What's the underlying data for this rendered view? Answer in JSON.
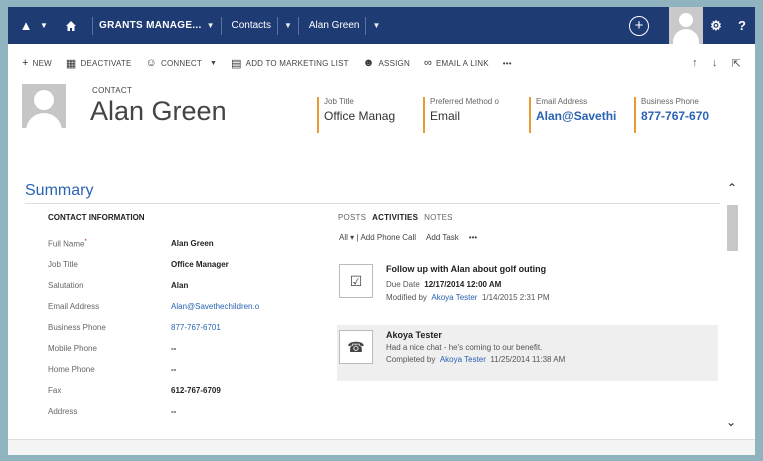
{
  "nav": {
    "module_label": "GRANTS MANAGE...",
    "entity_label": "Contacts",
    "record_label": "Alan Green",
    "help_label": "?"
  },
  "commands": {
    "new": "NEW",
    "deactivate": "DEACTIVATE",
    "connect": "CONNECT",
    "add_to_marketing_list": "ADD TO MARKETING LIST",
    "assign": "ASSIGN",
    "email_link": "EMAIL A LINK",
    "more": "•••"
  },
  "header": {
    "entity_type": "CONTACT",
    "name": "Alan Green",
    "fields": [
      {
        "label": "Job Title",
        "value": "Office Manag"
      },
      {
        "label": "Preferred Method o",
        "value": "Email"
      },
      {
        "label": "Email Address",
        "value": "Alan@Savethi"
      },
      {
        "label": "Business Phone",
        "value": "877-767-670"
      }
    ]
  },
  "summary": {
    "title": "Summary",
    "section_title": "CONTACT INFORMATION",
    "rows": [
      {
        "label": "Full Name",
        "required": "*",
        "value": "Alan Green"
      },
      {
        "label": "Job Title",
        "value": "Office Manager"
      },
      {
        "label": "Salutation",
        "value": "Alan"
      },
      {
        "label": "Email Address",
        "value": "Alan@Savethechildren.o"
      },
      {
        "label": "Business Phone",
        "value": "877-767-6701"
      },
      {
        "label": "Mobile Phone",
        "value": "--"
      },
      {
        "label": "Home Phone",
        "value": "--"
      },
      {
        "label": "Fax",
        "value": "612-767-6709"
      },
      {
        "label": "Address",
        "value": "--"
      }
    ]
  },
  "timeline": {
    "tabs": [
      "POSTS",
      "ACTIVITIES",
      "NOTES"
    ],
    "filter": "All",
    "add_phone_call": "Add Phone Call",
    "add_task": "Add Task",
    "more": "•••",
    "activities": [
      {
        "title": "Follow up with Alan about golf outing",
        "line1_prefix": "Due Date",
        "line1_value": "12/17/2014 12:00 AM",
        "line2_prefix": "Modified by",
        "line2_user": "Akoya Tester",
        "line2_date": "1/14/2015 2:31 PM",
        "icon": "task-check-icon"
      },
      {
        "title": "Akoya Tester",
        "line1_value": "Had a nice chat - he's coming to our benefit.",
        "line2_prefix": "Completed by",
        "line2_user": "Akoya Tester",
        "line2_date": "11/25/2014 11:38 AM",
        "icon": "phone-call-icon"
      }
    ]
  },
  "colors": {
    "nav_bg": "#1f3b73",
    "accent_link": "#2a63b3",
    "header_field_bar": "#e79b35"
  }
}
